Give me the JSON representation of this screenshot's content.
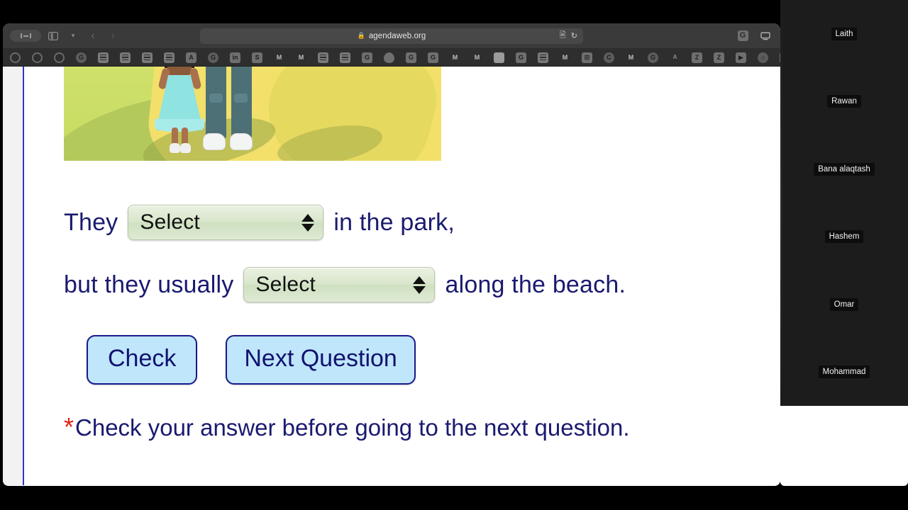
{
  "browser": {
    "url": "agendaweb.org",
    "lock_icon": "lock-icon",
    "sidebar_toggle_icon": "sidebar-toggle-icon",
    "tab_overview_icon": "tab-overview-icon",
    "tab_dropdown_icon": "chevron-down-icon",
    "back_icon": "back-arrow-icon",
    "forward_icon": "forward-arrow-icon",
    "extension_icon": "google-extension-icon",
    "screen_icon": "screen-share-icon",
    "reader_icon": "reader-view-icon",
    "reload_icon": "reload-icon",
    "bookmark_count": 36
  },
  "exercise": {
    "image_alt": "child-and-adult-walking-illustration",
    "line1": {
      "before": "They",
      "select_value": "Select",
      "after": "in the park,"
    },
    "line2": {
      "before": "but they usually",
      "select_value": "Select",
      "after": "along the beach."
    },
    "buttons": {
      "check": "Check",
      "next": "Next Question"
    },
    "note": {
      "marker": "*",
      "text": "Check your answer before going to the next question."
    },
    "colors": {
      "text_navy": "#1a1a70",
      "note_marker_red": "#e2231a",
      "button_fill": "#bfe6fb",
      "button_border": "#1a1a8c",
      "select_fill": "#d8e6cb",
      "margin_line": "#3333cc"
    }
  },
  "participants": [
    {
      "name": "Laith"
    },
    {
      "name": "Rawan"
    },
    {
      "name": "Bana alaqtash"
    },
    {
      "name": "Hashem"
    },
    {
      "name": "Omar"
    },
    {
      "name": "Mohammad"
    }
  ]
}
